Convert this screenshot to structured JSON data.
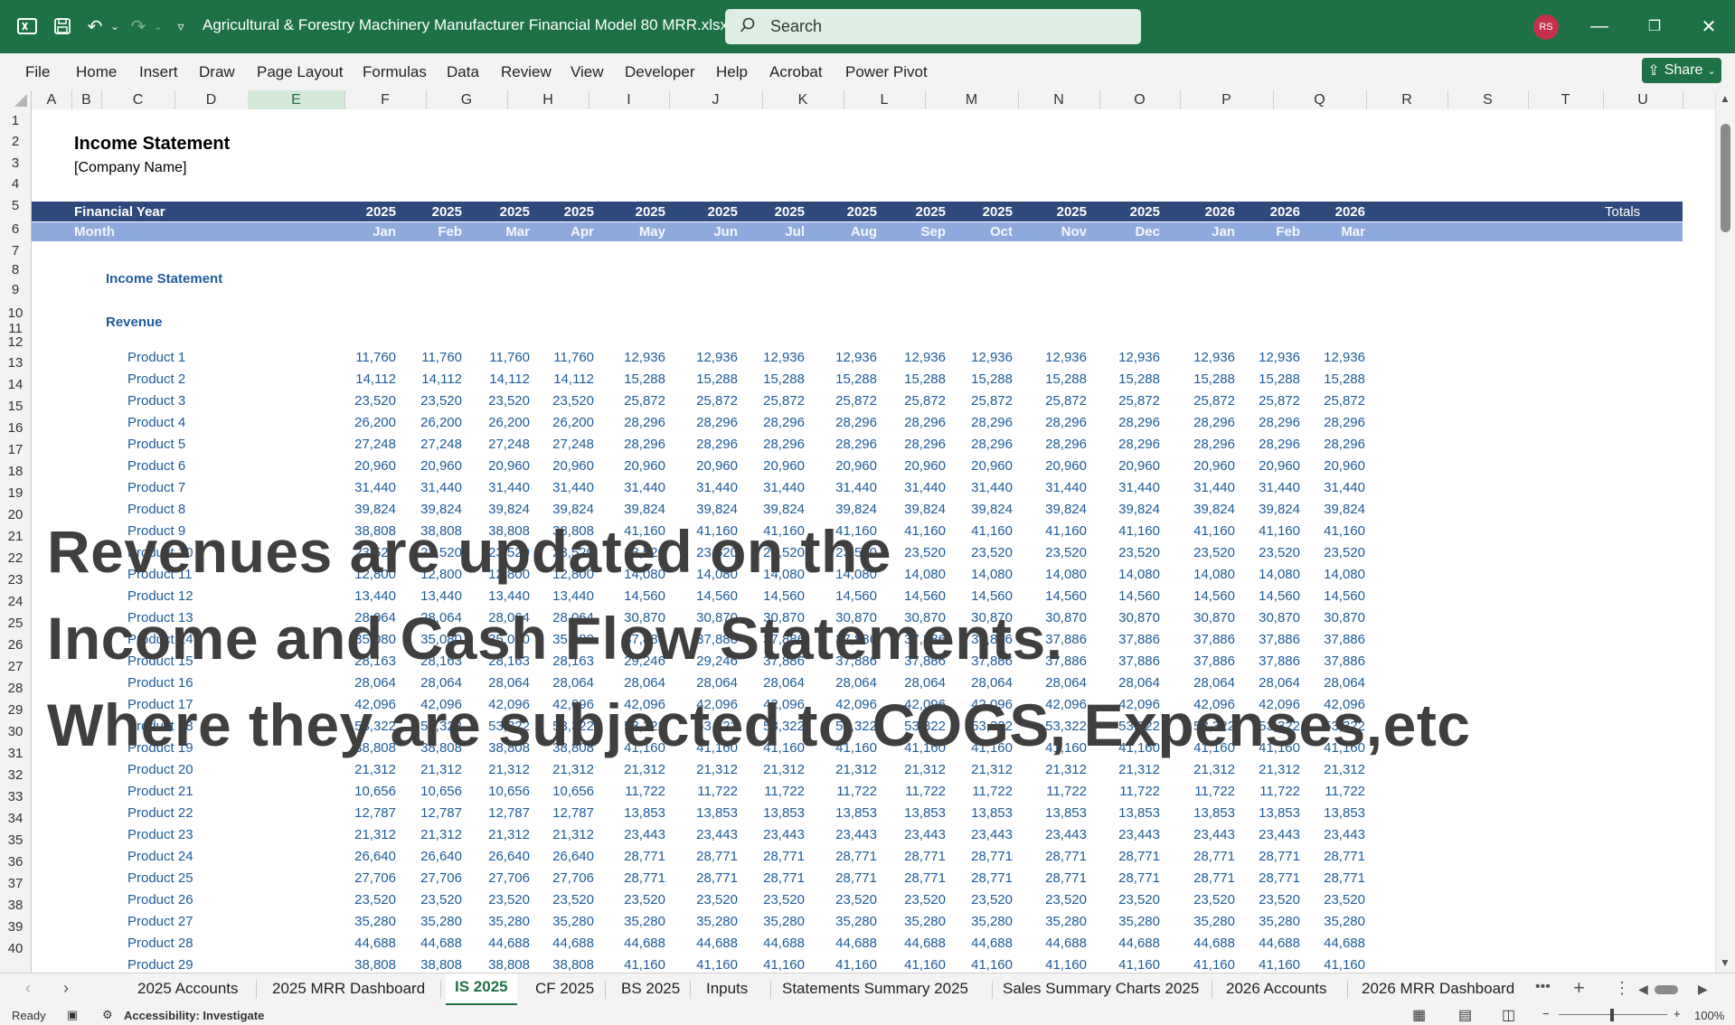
{
  "window": {
    "title": "Agricultural & Forestry Machinery Manufacturer Financial Model 80 MRR.xlsx  -  E...",
    "search_placeholder": "Search",
    "avatar_initials": "RS",
    "accent_color": "#1e7145"
  },
  "menu": [
    "File",
    "Home",
    "Insert",
    "Draw",
    "Page Layout",
    "Formulas",
    "Data",
    "Review",
    "View",
    "Developer",
    "Help",
    "Acrobat",
    "Power Pivot"
  ],
  "share_label": "Share",
  "columns": [
    "A",
    "B",
    "C",
    "D",
    "E",
    "F",
    "G",
    "H",
    "I",
    "J",
    "K",
    "L",
    "M",
    "N",
    "O",
    "P",
    "Q",
    "R",
    "S",
    "T",
    "U"
  ],
  "rows": [
    "1",
    "2",
    "3",
    "4",
    "5",
    "6",
    "7",
    "8",
    "9",
    "10",
    "11",
    "12",
    "13",
    "14",
    "15",
    "16",
    "17",
    "18",
    "19",
    "20",
    "21",
    "22",
    "23",
    "24",
    "25",
    "26",
    "27",
    "28",
    "29",
    "30",
    "31",
    "32",
    "33",
    "34",
    "35",
    "36",
    "37",
    "38",
    "39",
    "40"
  ],
  "sheet": {
    "title": "Income Statement",
    "company": "[Company Name]",
    "fy_label": "Financial Year",
    "month_label": "Month",
    "years": [
      "2025",
      "2025",
      "2025",
      "2025",
      "2025",
      "2025",
      "2025",
      "2025",
      "2025",
      "2025",
      "2025",
      "2025",
      "2026",
      "2026",
      "2026"
    ],
    "months": [
      "Jan",
      "Feb",
      "Mar",
      "Apr",
      "May",
      "Jun",
      "Jul",
      "Aug",
      "Sep",
      "Oct",
      "Nov",
      "Dec",
      "Jan",
      "Feb",
      "Mar"
    ],
    "totals_label": "Totals",
    "section_label": "Income Statement",
    "revenue_label": "Revenue",
    "products": [
      {
        "name": "Product 1",
        "values": [
          "11,760",
          "11,760",
          "11,760",
          "11,760",
          "12,936",
          "12,936",
          "12,936",
          "12,936",
          "12,936",
          "12,936",
          "12,936",
          "12,936",
          "12,936",
          "12,936",
          "12,936"
        ]
      },
      {
        "name": "Product 2",
        "values": [
          "14,112",
          "14,112",
          "14,112",
          "14,112",
          "15,288",
          "15,288",
          "15,288",
          "15,288",
          "15,288",
          "15,288",
          "15,288",
          "15,288",
          "15,288",
          "15,288",
          "15,288"
        ]
      },
      {
        "name": "Product 3",
        "values": [
          "23,520",
          "23,520",
          "23,520",
          "23,520",
          "25,872",
          "25,872",
          "25,872",
          "25,872",
          "25,872",
          "25,872",
          "25,872",
          "25,872",
          "25,872",
          "25,872",
          "25,872"
        ]
      },
      {
        "name": "Product 4",
        "values": [
          "26,200",
          "26,200",
          "26,200",
          "26,200",
          "28,296",
          "28,296",
          "28,296",
          "28,296",
          "28,296",
          "28,296",
          "28,296",
          "28,296",
          "28,296",
          "28,296",
          "28,296"
        ]
      },
      {
        "name": "Product 5",
        "values": [
          "27,248",
          "27,248",
          "27,248",
          "27,248",
          "28,296",
          "28,296",
          "28,296",
          "28,296",
          "28,296",
          "28,296",
          "28,296",
          "28,296",
          "28,296",
          "28,296",
          "28,296"
        ]
      },
      {
        "name": "Product 6",
        "values": [
          "20,960",
          "20,960",
          "20,960",
          "20,960",
          "20,960",
          "20,960",
          "20,960",
          "20,960",
          "20,960",
          "20,960",
          "20,960",
          "20,960",
          "20,960",
          "20,960",
          "20,960"
        ]
      },
      {
        "name": "Product 7",
        "values": [
          "31,440",
          "31,440",
          "31,440",
          "31,440",
          "31,440",
          "31,440",
          "31,440",
          "31,440",
          "31,440",
          "31,440",
          "31,440",
          "31,440",
          "31,440",
          "31,440",
          "31,440"
        ]
      },
      {
        "name": "Product 8",
        "values": [
          "39,824",
          "39,824",
          "39,824",
          "39,824",
          "39,824",
          "39,824",
          "39,824",
          "39,824",
          "39,824",
          "39,824",
          "39,824",
          "39,824",
          "39,824",
          "39,824",
          "39,824"
        ]
      },
      {
        "name": "Product 9",
        "values": [
          "38,808",
          "38,808",
          "38,808",
          "38,808",
          "41,160",
          "41,160",
          "41,160",
          "41,160",
          "41,160",
          "41,160",
          "41,160",
          "41,160",
          "41,160",
          "41,160",
          "41,160"
        ]
      },
      {
        "name": "Product 10",
        "values": [
          "23,520",
          "23,520",
          "23,520",
          "23,520",
          "23,520",
          "23,520",
          "23,520",
          "23,520",
          "23,520",
          "23,520",
          "23,520",
          "23,520",
          "23,520",
          "23,520",
          "23,520"
        ]
      },
      {
        "name": "Product 11",
        "values": [
          "12,800",
          "12,800",
          "12,800",
          "12,800",
          "14,080",
          "14,080",
          "14,080",
          "14,080",
          "14,080",
          "14,080",
          "14,080",
          "14,080",
          "14,080",
          "14,080",
          "14,080"
        ]
      },
      {
        "name": "Product 12",
        "values": [
          "13,440",
          "13,440",
          "13,440",
          "13,440",
          "14,560",
          "14,560",
          "14,560",
          "14,560",
          "14,560",
          "14,560",
          "14,560",
          "14,560",
          "14,560",
          "14,560",
          "14,560"
        ]
      },
      {
        "name": "Product 13",
        "values": [
          "28,064",
          "28,064",
          "28,064",
          "28,064",
          "30,870",
          "30,870",
          "30,870",
          "30,870",
          "30,870",
          "30,870",
          "30,870",
          "30,870",
          "30,870",
          "30,870",
          "30,870"
        ]
      },
      {
        "name": "Product 14",
        "values": [
          "35,080",
          "35,080",
          "35,080",
          "35,080",
          "37,886",
          "37,886",
          "37,886",
          "37,886",
          "37,886",
          "37,886",
          "37,886",
          "37,886",
          "37,886",
          "37,886",
          "37,886"
        ]
      },
      {
        "name": "Product 15",
        "values": [
          "28,163",
          "28,163",
          "28,163",
          "28,163",
          "29,246",
          "29,246",
          "37,886",
          "37,886",
          "37,886",
          "37,886",
          "37,886",
          "37,886",
          "37,886",
          "37,886",
          "37,886"
        ]
      },
      {
        "name": "Product 16",
        "values": [
          "28,064",
          "28,064",
          "28,064",
          "28,064",
          "28,064",
          "28,064",
          "28,064",
          "28,064",
          "28,064",
          "28,064",
          "28,064",
          "28,064",
          "28,064",
          "28,064",
          "28,064"
        ]
      },
      {
        "name": "Product 17",
        "values": [
          "42,096",
          "42,096",
          "42,096",
          "42,096",
          "42,096",
          "42,096",
          "42,096",
          "42,096",
          "42,096",
          "42,096",
          "42,096",
          "42,096",
          "42,096",
          "42,096",
          "42,096"
        ]
      },
      {
        "name": "Product 18",
        "values": [
          "53,322",
          "53,322",
          "53,322",
          "53,322",
          "53,322",
          "53,322",
          "53,322",
          "53,322",
          "53,322",
          "53,322",
          "53,322",
          "53,322",
          "53,322",
          "53,322",
          "53,322"
        ]
      },
      {
        "name": "Product 19",
        "values": [
          "38,808",
          "38,808",
          "38,808",
          "38,808",
          "41,160",
          "41,160",
          "41,160",
          "41,160",
          "41,160",
          "41,160",
          "41,160",
          "41,160",
          "41,160",
          "41,160",
          "41,160"
        ]
      },
      {
        "name": "Product 20",
        "values": [
          "21,312",
          "21,312",
          "21,312",
          "21,312",
          "21,312",
          "21,312",
          "21,312",
          "21,312",
          "21,312",
          "21,312",
          "21,312",
          "21,312",
          "21,312",
          "21,312",
          "21,312"
        ]
      },
      {
        "name": "Product 21",
        "values": [
          "10,656",
          "10,656",
          "10,656",
          "10,656",
          "11,722",
          "11,722",
          "11,722",
          "11,722",
          "11,722",
          "11,722",
          "11,722",
          "11,722",
          "11,722",
          "11,722",
          "11,722"
        ]
      },
      {
        "name": "Product 22",
        "values": [
          "12,787",
          "12,787",
          "12,787",
          "12,787",
          "13,853",
          "13,853",
          "13,853",
          "13,853",
          "13,853",
          "13,853",
          "13,853",
          "13,853",
          "13,853",
          "13,853",
          "13,853"
        ]
      },
      {
        "name": "Product 23",
        "values": [
          "21,312",
          "21,312",
          "21,312",
          "21,312",
          "23,443",
          "23,443",
          "23,443",
          "23,443",
          "23,443",
          "23,443",
          "23,443",
          "23,443",
          "23,443",
          "23,443",
          "23,443"
        ]
      },
      {
        "name": "Product 24",
        "values": [
          "26,640",
          "26,640",
          "26,640",
          "26,640",
          "28,771",
          "28,771",
          "28,771",
          "28,771",
          "28,771",
          "28,771",
          "28,771",
          "28,771",
          "28,771",
          "28,771",
          "28,771"
        ]
      },
      {
        "name": "Product 25",
        "values": [
          "27,706",
          "27,706",
          "27,706",
          "27,706",
          "28,771",
          "28,771",
          "28,771",
          "28,771",
          "28,771",
          "28,771",
          "28,771",
          "28,771",
          "28,771",
          "28,771",
          "28,771"
        ]
      },
      {
        "name": "Product 26",
        "values": [
          "23,520",
          "23,520",
          "23,520",
          "23,520",
          "23,520",
          "23,520",
          "23,520",
          "23,520",
          "23,520",
          "23,520",
          "23,520",
          "23,520",
          "23,520",
          "23,520",
          "23,520"
        ]
      },
      {
        "name": "Product 27",
        "values": [
          "35,280",
          "35,280",
          "35,280",
          "35,280",
          "35,280",
          "35,280",
          "35,280",
          "35,280",
          "35,280",
          "35,280",
          "35,280",
          "35,280",
          "35,280",
          "35,280",
          "35,280"
        ]
      },
      {
        "name": "Product 28",
        "values": [
          "44,688",
          "44,688",
          "44,688",
          "44,688",
          "44,688",
          "44,688",
          "44,688",
          "44,688",
          "44,688",
          "44,688",
          "44,688",
          "44,688",
          "44,688",
          "44,688",
          "44,688"
        ]
      },
      {
        "name": "Product 29",
        "values": [
          "38,808",
          "38,808",
          "38,808",
          "38,808",
          "41,160",
          "41,160",
          "41,160",
          "41,160",
          "41,160",
          "41,160",
          "41,160",
          "41,160",
          "41,160",
          "41,160",
          "41,160"
        ]
      }
    ]
  },
  "overlay": {
    "line1": "Revenues are updated on the",
    "line2": "Income and Cash Flow Statements.",
    "line3": "Where they are subjected to COGS, Expenses,etc"
  },
  "tabs": [
    "2025 Accounts",
    "2025 MRR Dashboard",
    "IS 2025",
    "CF 2025",
    "BS 2025",
    "Inputs",
    "Statements Summary 2025",
    "Sales Summary Charts 2025",
    "2026 Accounts",
    "2026 MRR Dashboard"
  ],
  "active_tab": "IS 2025",
  "status": {
    "ready": "Ready",
    "accessibility": "Accessibility: Investigate",
    "zoom": "100%"
  }
}
